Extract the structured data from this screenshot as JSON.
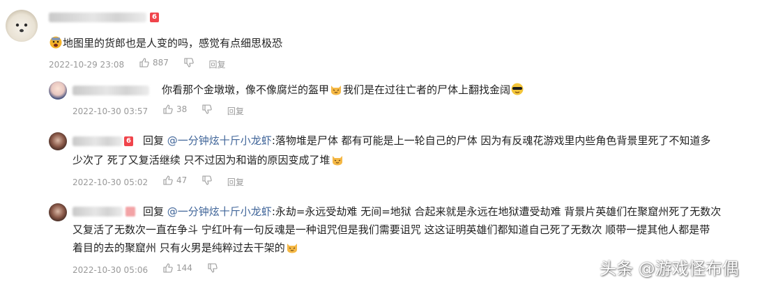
{
  "colors": {
    "text": "#222222",
    "meta": "#999999",
    "mention": "#406599",
    "level_badge": "#f0444b"
  },
  "comments": [
    {
      "level_badge": "6",
      "text": "地图里的货郎也是人变的吗，感觉有点细思极恐",
      "date": "2022-10-29 23:08",
      "likes": "887",
      "reply_label": "回复",
      "prefix_emoji": "scared-face-emoji"
    },
    {
      "text_before_emoji": "你看那个金墩墩，像不像腐烂的盔甲",
      "text_after_emoji": "我们是在过往亡者的尸体上翻找金阔",
      "emoji_1": "cat-face-emoji",
      "emoji_2": "sunglasses-face-emoji",
      "date": "2022-10-30 03:57",
      "likes": "38",
      "reply_label": "回复"
    },
    {
      "level_badge": "6",
      "reply_word": "回复",
      "mention": "@一分钟炫十斤小龙虾",
      "line1": ":落物堆是尸体 都有可能是上一轮自己的尸体 因为有反魂花游戏里内些角色背景里死了不知道多",
      "line2": "少次了 死了又复活继续 只不过因为和谐的原因变成了堆",
      "end_emoji": "cat-face-emoji",
      "date": "2022-10-30 05:02",
      "likes": "47",
      "reply_label": "回复"
    },
    {
      "reply_word": "回复",
      "mention": "@一分钟炫十斤小龙虾",
      "line1": ":永劫=永远受劫难 无间=地狱 合起来就是永远在地狱遭受劫难 背景片英雄们在聚窟州死了无数次",
      "line2": "又复活了无数次一直在争斗 宁红叶有一句反魂是一种诅咒但是我们需要诅咒 这这证明英雄们都知道自己死了无数次 顺带一提其他人都是带",
      "line3": "着目的去的聚窟州 只有火男是纯粹过去干架的",
      "end_emoji": "cat-face-emoji",
      "date": "2022-10-30 05:06",
      "likes": "144"
    }
  ],
  "watermark": "头条 @游戏怪布偶"
}
